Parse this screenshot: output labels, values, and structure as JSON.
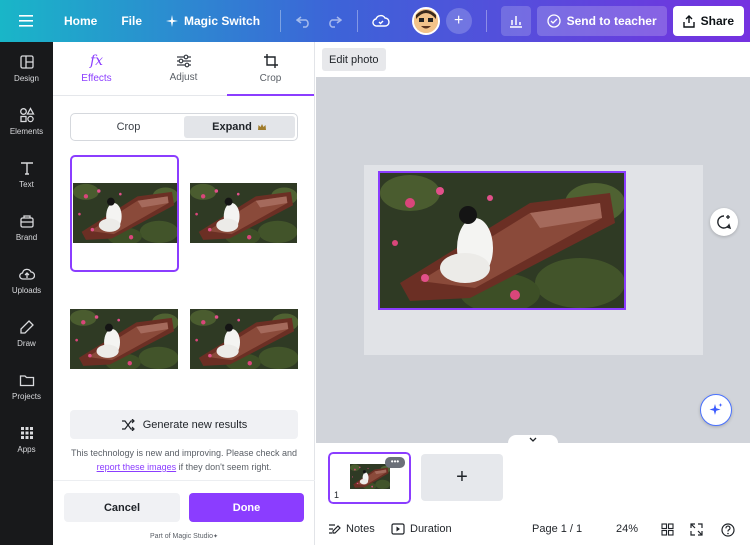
{
  "topbar": {
    "home_label": "Home",
    "file_label": "File",
    "magic_switch_label": "Magic Switch",
    "send_to_teacher_label": "Send to teacher",
    "share_label": "Share"
  },
  "rail": {
    "items": [
      {
        "label": "Design",
        "icon": "design-icon"
      },
      {
        "label": "Elements",
        "icon": "elements-icon"
      },
      {
        "label": "Text",
        "icon": "text-icon"
      },
      {
        "label": "Brand",
        "icon": "brand-icon"
      },
      {
        "label": "Uploads",
        "icon": "uploads-icon"
      },
      {
        "label": "Draw",
        "icon": "draw-icon"
      },
      {
        "label": "Projects",
        "icon": "projects-icon"
      },
      {
        "label": "Apps",
        "icon": "apps-icon"
      }
    ]
  },
  "panel": {
    "tabs": [
      {
        "label": "Effects",
        "icon": "fx-icon"
      },
      {
        "label": "Adjust",
        "icon": "sliders-icon"
      },
      {
        "label": "Crop",
        "icon": "crop-icon"
      }
    ],
    "active_tab": "Crop",
    "segment": {
      "crop_label": "Crop",
      "expand_label": "Expand",
      "selected": "Expand"
    },
    "generate_label": "Generate new results",
    "note_prefix": "This technology is new and improving. Please check and ",
    "note_link": "report these images",
    "note_suffix": " if they don't seem right.",
    "cancel_label": "Cancel",
    "done_label": "Done",
    "studio_label": "Part of Magic Studio"
  },
  "canvas": {
    "edit_photo_label": "Edit photo"
  },
  "pages": {
    "current_page_number": "1",
    "more_label": "•••",
    "add_label": "+"
  },
  "status": {
    "notes_label": "Notes",
    "duration_label": "Duration",
    "page_label": "Page 1 / 1",
    "zoom_label": "24%"
  },
  "colors": {
    "accent": "#8b3dff",
    "rail_bg": "#18191b",
    "workspace_bg": "#d1d4da"
  }
}
